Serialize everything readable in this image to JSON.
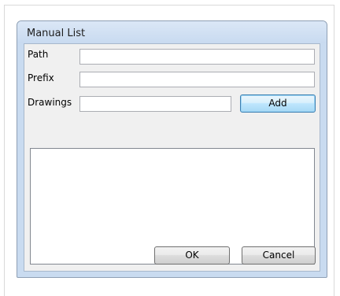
{
  "window": {
    "title": "Manual List"
  },
  "fields": {
    "path_label": "Path",
    "path_value": "",
    "prefix_label": "Prefix",
    "prefix_value": "",
    "drawings_label": "Drawings",
    "drawings_value": ""
  },
  "buttons": {
    "add_label": "Add",
    "ok_label": "OK",
    "cancel_label": "Cancel"
  },
  "list": {
    "items": []
  }
}
